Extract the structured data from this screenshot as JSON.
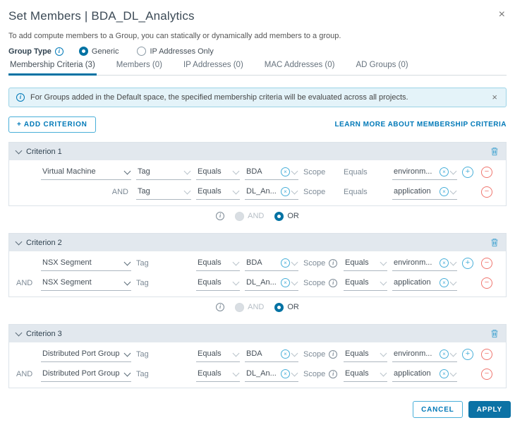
{
  "icons": {
    "close_x": "×",
    "banner_close_x": "×",
    "clear_x": "×",
    "plus": "+",
    "minus": "−",
    "info_i": "i"
  },
  "colors": {
    "accent": "#0079b8",
    "accent_dark": "#0072a3",
    "icon_blue": "#49afd9",
    "danger": "#f0766f",
    "primary_button": "#0c72a5"
  },
  "header": {
    "title": "Set Members | BDA_DL_Analytics"
  },
  "intro": "To add compute members to a Group, you can statically or dynamically add members to a group.",
  "group_type": {
    "label": "Group Type",
    "generic": "Generic",
    "ip_only": "IP Addresses Only"
  },
  "tabs": [
    {
      "label": "Membership Criteria (3)"
    },
    {
      "label": "Members (0)"
    },
    {
      "label": "IP Addresses (0)"
    },
    {
      "label": "MAC Addresses (0)"
    },
    {
      "label": "AD Groups (0)"
    }
  ],
  "banner": {
    "text": "For Groups added in the Default space, the specified membership criteria will be evaluated across all projects."
  },
  "toolbar": {
    "add_criterion": "+ ADD CRITERION",
    "learn_more": "LEARN MORE ABOUT MEMBERSHIP CRITERIA"
  },
  "labels": {
    "scope": "Scope",
    "equals": "Equals"
  },
  "connector": {
    "and": "AND",
    "or": "OR"
  },
  "criteria": [
    {
      "title": "Criterion 1",
      "rows": [
        {
          "and": "",
          "entity": "Virtual Machine",
          "property": "Tag",
          "operator": "Equals",
          "value": "BDA",
          "scope_label": "Scope",
          "scope_op": "Equals",
          "scope_value": "environm..."
        },
        {
          "and": "AND",
          "entity": "",
          "property": "Tag",
          "operator": "Equals",
          "value": "DL_An...",
          "scope_label": "Scope",
          "scope_op": "Equals",
          "scope_value": "application"
        }
      ]
    },
    {
      "title": "Criterion 2",
      "rows": [
        {
          "and": "",
          "entity": "NSX Segment",
          "property": "Tag",
          "operator": "Equals",
          "value": "BDA",
          "scope_label": "Scope",
          "scope_op": "Equals",
          "scope_value": "environm..."
        },
        {
          "and": "AND",
          "entity": "NSX Segment",
          "property": "Tag",
          "operator": "Equals",
          "value": "DL_An...",
          "scope_label": "Scope",
          "scope_op": "Equals",
          "scope_value": "application"
        }
      ]
    },
    {
      "title": "Criterion 3",
      "rows": [
        {
          "and": "",
          "entity": "Distributed Port Group",
          "property": "Tag",
          "operator": "Equals",
          "value": "BDA",
          "scope_label": "Scope",
          "scope_op": "Equals",
          "scope_value": "environm..."
        },
        {
          "and": "AND",
          "entity": "Distributed Port Group",
          "property": "Tag",
          "operator": "Equals",
          "value": "DL_An...",
          "scope_label": "Scope",
          "scope_op": "Equals",
          "scope_value": "application"
        }
      ]
    }
  ],
  "footer": {
    "cancel": "CANCEL",
    "apply": "APPLY"
  }
}
